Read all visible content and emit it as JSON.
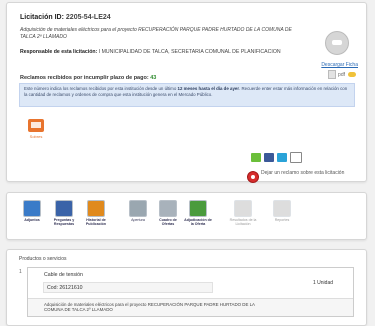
{
  "licitacion": {
    "header_label": "Licitación ID:",
    "id": "2205-54-LE24",
    "description": "Adquisición de materiales eléctricos para el proyecto RECUPERACIÓN PARQUE PADRE HURTADO DE LA COMUNA DE TALCA 2º LLAMADO",
    "responsible_label": "Responsable de esta licitación:",
    "responsible_value": "I MUNICIPALIDAD DE TALCA, SECRETARIA COMUNAL DE PLANIFICACION",
    "claims_label": "Reclamos recibidos por incumplir plazo de pago:",
    "claims_count": "43",
    "notice_text_1": "Este número indica los reclamos recibidos por esta institución desde un último",
    "notice_bold": "12 meses hasta el día de ayer",
    "notice_text_2": "Recuerde enter estar más información en relación con la cantidad de reclamos y ordenes de compra que esta institución genera en el Mercado Público.",
    "download_label": "Descargar Ficha",
    "file_label": "pdf",
    "sobre_label": "Sobres",
    "reclamo_label": "Dejar un reclamo sobre esta licitación"
  },
  "toolbar": [
    {
      "label": "Adjuntos",
      "color": "#3a7bc8"
    },
    {
      "label": "Preguntas y Respuestas",
      "color": "#3a63a8"
    },
    {
      "label": "Historial de Publicación",
      "color": "#e08a1e"
    },
    {
      "label": "Apertura",
      "color": "#9aa7b0"
    },
    {
      "label": "Cuadro de Ofertas",
      "color": "#a8b2bb"
    },
    {
      "label": "Adjudicación de la Oferta",
      "color": "#4a9b3d"
    },
    {
      "label": "Resultados de la Licitación",
      "color": "#b4b4b4"
    },
    {
      "label": "Reportes",
      "color": "#b4b4b4"
    }
  ],
  "products": {
    "title": "Productos o servicios",
    "index": "1",
    "name": "Cable de tensión",
    "code": "Cod: 26121610",
    "quantity": "1 Unidad",
    "description": "Adquisición de materiales eléctricos para el proyecto RECUPERACIÓN PARQUE PADRE HURTADO DE LA COMUNA DE TALCA 2º LLAMADO"
  }
}
